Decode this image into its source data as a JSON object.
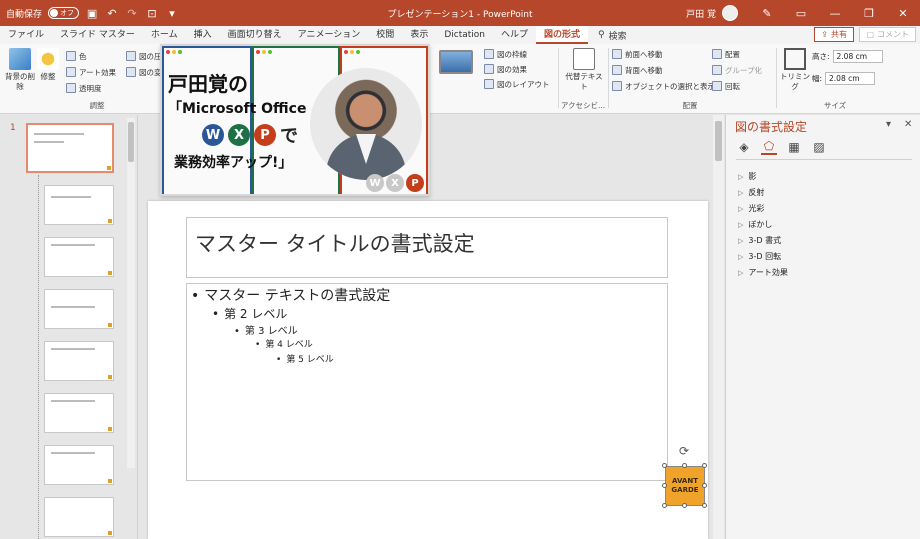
{
  "titlebar": {
    "autosave_label": "自動保存",
    "autosave_state": "オフ",
    "doc_title": "プレゼンテーション1  -  PowerPoint",
    "user_name": "戸田 覚"
  },
  "tabs": [
    "ファイル",
    "スライド マスター",
    "ホーム",
    "挿入",
    "画面切り替え",
    "アニメーション",
    "校閲",
    "表示",
    "Dictation",
    "ヘルプ",
    "図の形式"
  ],
  "active_tab": "図の形式",
  "search_label": "検索",
  "share_label": "共有",
  "comment_label": "コメント",
  "ribbon": {
    "remove_bg": "背景の削除",
    "corrections": "修整",
    "color": "色",
    "artistic": "アート効果",
    "transparency": "透明度",
    "compress": "図の圧",
    "change": "図の変",
    "adjust_group": "調整",
    "picture_border": "図の枠線",
    "picture_effects": "図の効果",
    "picture_layout": "図のレイアウト",
    "alt_text": "代替テキスト",
    "accessibility_group": "アクセシビ...",
    "bring_forward": "前面へ移動",
    "send_backward": "背面へ移動",
    "selection_pane": "オブジェクトの選択と表示",
    "align": "配置",
    "group": "グループ化",
    "rotate": "回転",
    "arrange_group": "配置",
    "crop": "トリミング",
    "height_label": "高さ:",
    "height_value": "2.08 cm",
    "width_label": "幅:",
    "width_value": "2.08 cm",
    "size_group": "サイズ"
  },
  "thumbnail_panel": {
    "slide_number": "1"
  },
  "slide": {
    "title_placeholder": "マスター タイトルの書式設定",
    "levels": [
      "マスター テキストの書式設定",
      "第 2 レベル",
      "第 3 レベル",
      "第 4 レベル",
      "第 5 レベル"
    ],
    "logo_line1": "AVANT",
    "logo_line2": "GARDE"
  },
  "banner": {
    "line1": "戸田覚の",
    "line2": "「Microsoft Office",
    "line3_suffix": "で",
    "line4": "業務効率アップ!」",
    "badge_w": "W",
    "badge_x": "X",
    "badge_p": "P",
    "colors": {
      "word": "#2b5797",
      "excel": "#1e7145",
      "ppt": "#c43e1c"
    }
  },
  "format_pane": {
    "title": "図の書式設定",
    "sections": [
      "影",
      "反射",
      "光彩",
      "ぼかし",
      "3-D 書式",
      "3-D 回転",
      "アート効果"
    ]
  },
  "colors": {
    "accent": "#b7472a"
  }
}
